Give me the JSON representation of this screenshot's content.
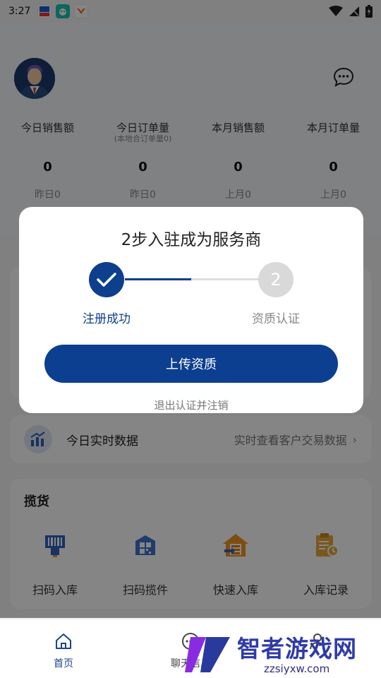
{
  "status_bar": {
    "time": "3:27"
  },
  "header": {
    "stats": [
      {
        "label": "今日销售额",
        "sub": "",
        "value": "0",
        "prev": "昨日0"
      },
      {
        "label": "今日订单量",
        "sub": "(本地合订单量0)",
        "value": "0",
        "prev": "昨日0"
      },
      {
        "label": "本月销售额",
        "sub": "",
        "value": "0",
        "prev": "上月0"
      },
      {
        "label": "本月订单量",
        "sub": "",
        "value": "0",
        "prev": "上月0"
      }
    ]
  },
  "realtime": {
    "title": "今日实时数据",
    "link": "实时查看客户交易数据"
  },
  "tools": {
    "title": "揽货",
    "items": [
      {
        "label": "扫码入库"
      },
      {
        "label": "扫码揽件"
      },
      {
        "label": "快速入库"
      },
      {
        "label": "入库记录"
      }
    ]
  },
  "nav": {
    "items": [
      {
        "label": "首页"
      },
      {
        "label": "聊天信息"
      },
      {
        "label": ""
      }
    ]
  },
  "modal": {
    "title": "2步入驻成为服务商",
    "step1_label": "注册成功",
    "step2_number": "2",
    "step2_label": "资质认证",
    "upload_button": "上传资质",
    "logout_link": "退出认证并注销"
  },
  "watermark": {
    "text": "智者游戏网",
    "url": "zzsiyxw.com"
  },
  "colors": {
    "primary": "#0c3f8f",
    "overlay": "rgba(0,0,0,0.48)"
  }
}
